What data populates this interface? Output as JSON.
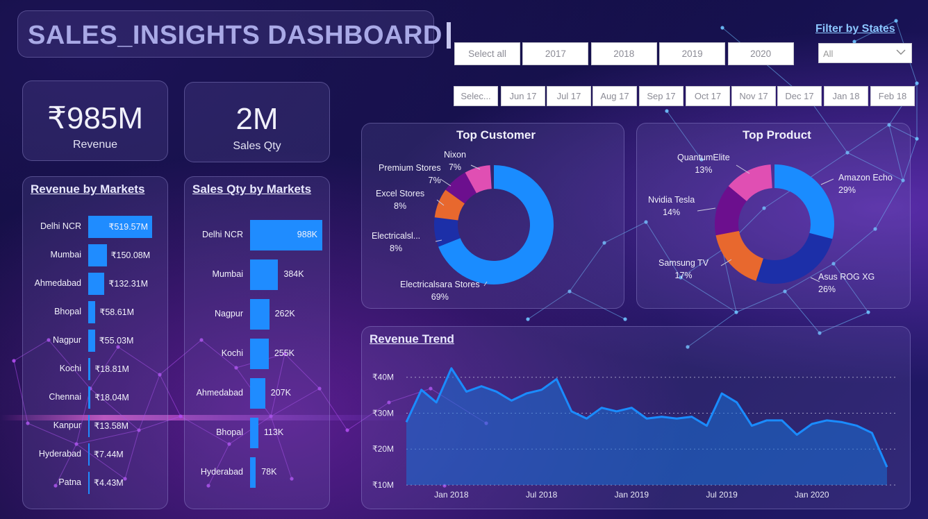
{
  "dashboard": {
    "title": "SALES_INSIGHTS DASHBOARD"
  },
  "kpis": {
    "revenue": {
      "value": "₹985M",
      "label": "Revenue"
    },
    "sales_qty": {
      "value": "2M",
      "label": "Sales Qty"
    }
  },
  "filters": {
    "years": [
      "Select all",
      "2017",
      "2018",
      "2019",
      "2020"
    ],
    "months": [
      "Selec...",
      "Jun 17",
      "Jul 17",
      "Aug 17",
      "Sep 17",
      "Oct 17",
      "Nov 17",
      "Dec 17",
      "Jan 18",
      "Feb 18"
    ],
    "states_title": "Filter by States",
    "states_selected": "All",
    "dropdown_icon": "chevron-down-icon"
  },
  "revenue_by_markets": {
    "title": "Revenue by Markets",
    "items": [
      {
        "market": "Delhi NCR",
        "value": 519.57,
        "label": "₹519.57M"
      },
      {
        "market": "Mumbai",
        "value": 150.08,
        "label": "₹150.08M"
      },
      {
        "market": "Ahmedabad",
        "value": 132.31,
        "label": "₹132.31M"
      },
      {
        "market": "Bhopal",
        "value": 58.61,
        "label": "₹58.61M"
      },
      {
        "market": "Nagpur",
        "value": 55.03,
        "label": "₹55.03M"
      },
      {
        "market": "Kochi",
        "value": 18.81,
        "label": "₹18.81M"
      },
      {
        "market": "Chennai",
        "value": 18.04,
        "label": "₹18.04M"
      },
      {
        "market": "Kanpur",
        "value": 13.58,
        "label": "₹13.58M"
      },
      {
        "market": "Hyderabad",
        "value": 7.44,
        "label": "₹7.44M"
      },
      {
        "market": "Patna",
        "value": 4.43,
        "label": "₹4.43M"
      }
    ]
  },
  "sales_qty_by_markets": {
    "title": "Sales Qty by Markets",
    "items": [
      {
        "market": "Delhi NCR",
        "value": 988,
        "label": "988K"
      },
      {
        "market": "Mumbai",
        "value": 384,
        "label": "384K"
      },
      {
        "market": "Nagpur",
        "value": 262,
        "label": "262K"
      },
      {
        "market": "Kochi",
        "value": 255,
        "label": "255K"
      },
      {
        "market": "Ahmedabad",
        "value": 207,
        "label": "207K"
      },
      {
        "market": "Bhopal",
        "value": 113,
        "label": "113K"
      },
      {
        "market": "Hyderabad",
        "value": 78,
        "label": "78K"
      }
    ]
  },
  "top_customer": {
    "title": "Top Customer",
    "slices": [
      {
        "name": "Electricalsara Stores",
        "pct": 69,
        "label": "69%",
        "color": "#1a8cff"
      },
      {
        "name": "Electricalsl...",
        "pct": 8,
        "label": "8%",
        "color": "#1c2fa8"
      },
      {
        "name": "Excel Stores",
        "pct": 8,
        "label": "8%",
        "color": "#e8682e"
      },
      {
        "name": "Premium Stores",
        "pct": 7,
        "label": "7%",
        "color": "#6c0f8e"
      },
      {
        "name": "Nixon",
        "pct": 7,
        "label": "7%",
        "color": "#e04fb3"
      }
    ]
  },
  "top_product": {
    "title": "Top Product",
    "slices": [
      {
        "name": "Amazon Echo",
        "pct": 29,
        "label": "29%",
        "color": "#1a8cff"
      },
      {
        "name": "Asus ROG XG",
        "pct": 26,
        "label": "26%",
        "color": "#1c2fa8"
      },
      {
        "name": "Samsung TV",
        "pct": 17,
        "label": "17%",
        "color": "#e8682e"
      },
      {
        "name": "Nvidia Tesla",
        "pct": 14,
        "label": "14%",
        "color": "#6c0f8e"
      },
      {
        "name": "QuantumElite",
        "pct": 13,
        "label": "13%",
        "color": "#e04fb3"
      }
    ]
  },
  "chart_data": {
    "type": "area",
    "title": "Revenue Trend",
    "x_ticks": [
      "Jan 2018",
      "Jul 2018",
      "Jan 2019",
      "Jul 2019",
      "Jan 2020"
    ],
    "y_ticks": [
      "₹10M",
      "₹20M",
      "₹30M",
      "₹40M"
    ],
    "ylim": [
      10,
      44
    ],
    "x": [
      "2017-10",
      "2017-11",
      "2017-12",
      "2018-01",
      "2018-02",
      "2018-03",
      "2018-04",
      "2018-05",
      "2018-06",
      "2018-07",
      "2018-08",
      "2018-09",
      "2018-10",
      "2018-11",
      "2018-12",
      "2019-01",
      "2019-02",
      "2019-03",
      "2019-04",
      "2019-05",
      "2019-06",
      "2019-07",
      "2019-08",
      "2019-09",
      "2019-10",
      "2019-11",
      "2019-12",
      "2020-01",
      "2020-02",
      "2020-03",
      "2020-04",
      "2020-05",
      "2020-06"
    ],
    "values": [
      27.5,
      36.5,
      33.0,
      42.5,
      36.0,
      37.5,
      36.0,
      33.5,
      35.5,
      36.5,
      39.5,
      30.5,
      28.5,
      31.5,
      30.5,
      31.5,
      28.5,
      29.0,
      28.5,
      29.0,
      26.5,
      35.5,
      33.0,
      26.5,
      28.0,
      28.0,
      24.0,
      27.0,
      28.0,
      27.5,
      26.5,
      24.5,
      15.0
    ],
    "line_color": "#1a8cff",
    "grid": true
  }
}
